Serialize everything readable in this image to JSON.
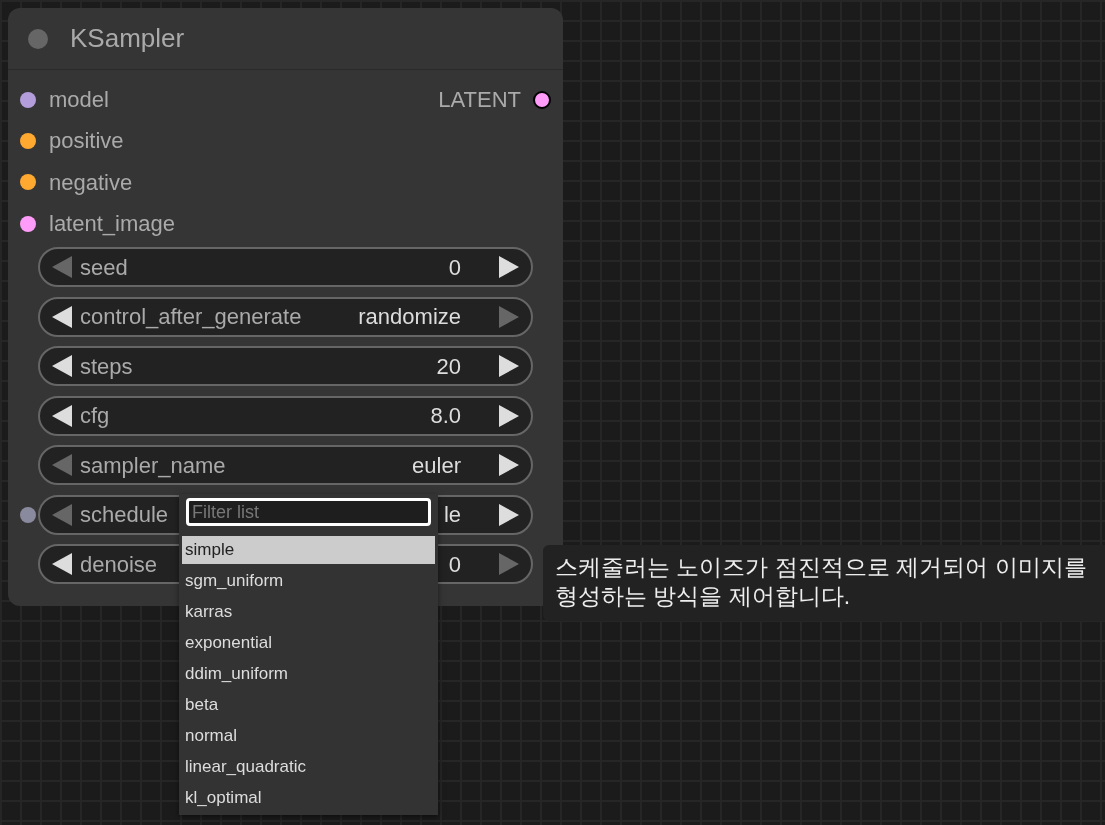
{
  "node": {
    "title": "KSampler",
    "inputs": [
      {
        "label": "model",
        "color": "#b39ddb"
      },
      {
        "label": "positive",
        "color": "#ffa931"
      },
      {
        "label": "negative",
        "color": "#ffa931"
      },
      {
        "label": "latent_image",
        "color": "#ff9cf9"
      }
    ],
    "outputs": [
      {
        "label": "LATENT",
        "color": "#ff9cf9"
      }
    ],
    "widgets": [
      {
        "label": "seed",
        "value": "0",
        "left_enabled": false,
        "right_enabled": true,
        "input_socket": false
      },
      {
        "label": "control_after_generate",
        "value": "randomize",
        "left_enabled": true,
        "right_enabled": false,
        "input_socket": false
      },
      {
        "label": "steps",
        "value": "20",
        "left_enabled": true,
        "right_enabled": true,
        "input_socket": false
      },
      {
        "label": "cfg",
        "value": "8.0",
        "left_enabled": true,
        "right_enabled": true,
        "input_socket": false
      },
      {
        "label": "sampler_name",
        "value": "euler",
        "left_enabled": false,
        "right_enabled": true,
        "input_socket": false
      },
      {
        "label": "schedule",
        "value": "le",
        "left_enabled": false,
        "right_enabled": true,
        "input_socket": true
      },
      {
        "label": "denoise",
        "value": "0",
        "left_enabled": true,
        "right_enabled": false,
        "input_socket": false
      }
    ]
  },
  "dropdown": {
    "placeholder": "Filter list",
    "items": [
      {
        "label": "simple",
        "selected": true
      },
      {
        "label": "sgm_uniform",
        "selected": false
      },
      {
        "label": "karras",
        "selected": false
      },
      {
        "label": "exponential",
        "selected": false
      },
      {
        "label": "ddim_uniform",
        "selected": false
      },
      {
        "label": "beta",
        "selected": false
      },
      {
        "label": "normal",
        "selected": false
      },
      {
        "label": "linear_quadratic",
        "selected": false
      },
      {
        "label": "kl_optimal",
        "selected": false
      }
    ]
  },
  "tooltip": {
    "text": "스케줄러는 노이즈가 점진적으로 제거되어 이미지를 형성하는 방식을 제어합니다."
  }
}
